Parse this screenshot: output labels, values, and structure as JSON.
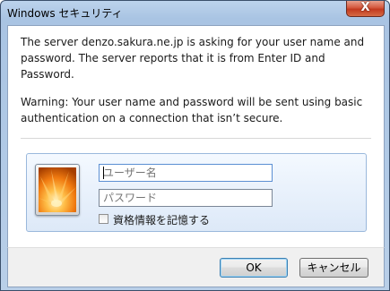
{
  "window": {
    "title": "Windows セキュリティ",
    "close_label": "X"
  },
  "message": {
    "line1": "The server denzo.sakura.ne.jp is asking for your user name and password. The server reports that it is from Enter ID and Password.",
    "line2": "Warning: Your user name and password will be sent using basic authentication on a connection that isn’t secure."
  },
  "credentials": {
    "username_placeholder": "ユーザー名",
    "password_placeholder": "パスワード",
    "remember_label": "資格情報を記憶する",
    "remember_checked": false
  },
  "buttons": {
    "ok": "OK",
    "cancel": "キャンセル"
  }
}
